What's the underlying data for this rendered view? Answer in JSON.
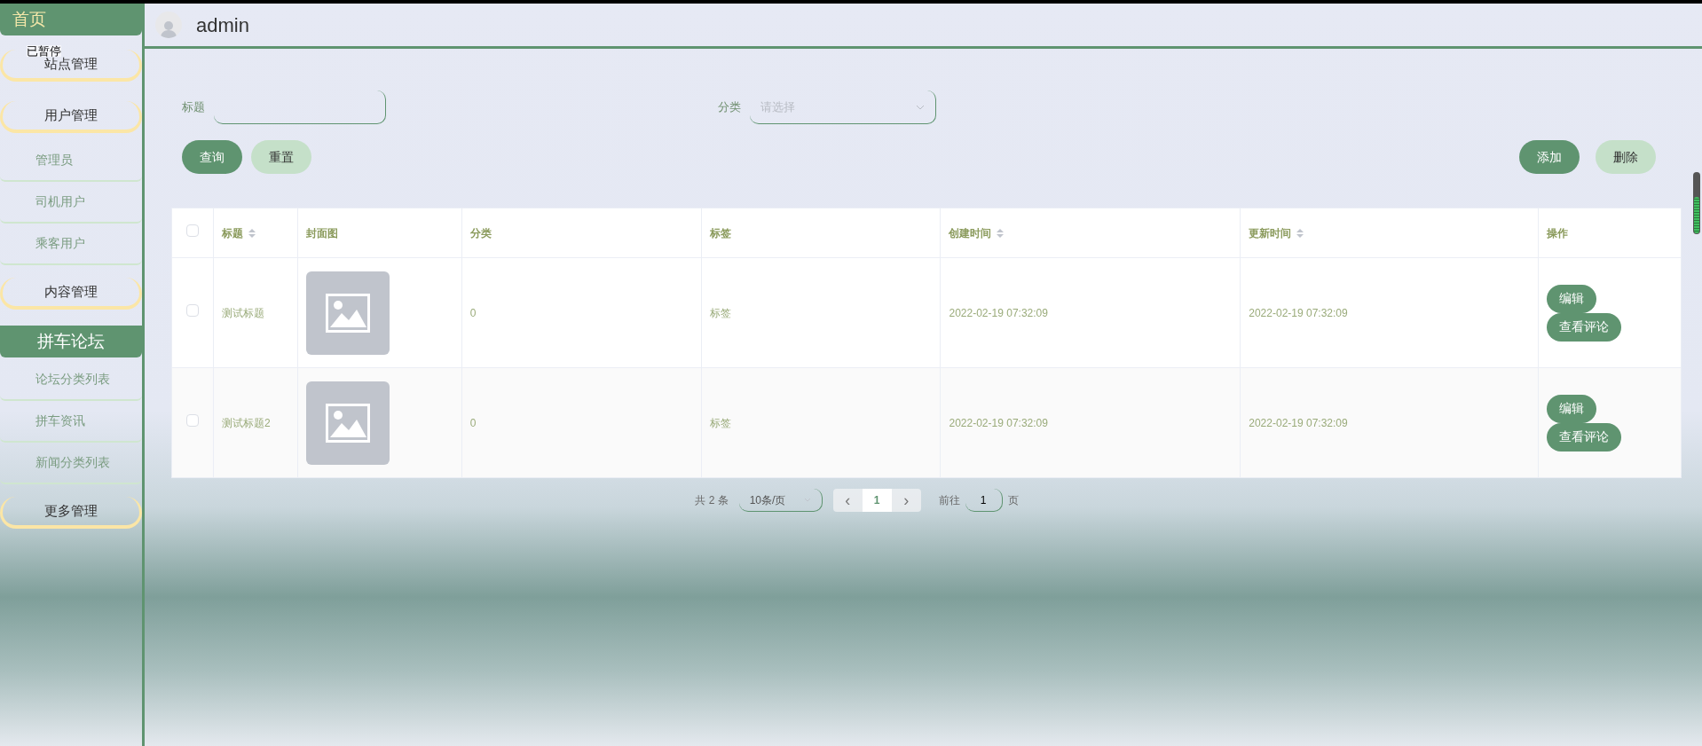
{
  "sidebar": {
    "items": [
      {
        "kind": "header",
        "label": "首页"
      },
      {
        "kind": "group",
        "label": "站点管理"
      },
      {
        "kind": "group",
        "label": "用户管理"
      },
      {
        "kind": "sub",
        "label": "管理员"
      },
      {
        "kind": "sub",
        "label": "司机用户"
      },
      {
        "kind": "sub",
        "label": "乘客用户"
      },
      {
        "kind": "group",
        "label": "内容管理"
      },
      {
        "kind": "header",
        "label": "拼车论坛"
      },
      {
        "kind": "sub",
        "label": "论坛分类列表"
      },
      {
        "kind": "sub",
        "label": "拼车资讯"
      },
      {
        "kind": "sub",
        "label": "新闻分类列表"
      },
      {
        "kind": "group",
        "label": "更多管理"
      }
    ],
    "overlay_text": "已暂停"
  },
  "header": {
    "username": "admin"
  },
  "filters": [
    {
      "kind": "text",
      "label": "标题"
    },
    {
      "kind": "select",
      "label": "分类",
      "placeholder": "请选择"
    }
  ],
  "left_buttons": [
    {
      "label": "查询",
      "primary": true
    },
    {
      "label": "重置",
      "primary": false
    }
  ],
  "right_buttons": [
    {
      "label": "添加",
      "primary": true
    },
    {
      "label": "删除",
      "primary": false
    }
  ],
  "table": {
    "select_all_checked": false,
    "columns": [
      {
        "label": "标题",
        "sortable": true
      },
      {
        "label": "封面图",
        "sortable": false
      },
      {
        "label": "分类",
        "sortable": false
      },
      {
        "label": "标签",
        "sortable": false
      },
      {
        "label": "创建时间",
        "sortable": true
      },
      {
        "label": "更新时间",
        "sortable": true
      },
      {
        "label": "操作",
        "sortable": false
      }
    ],
    "rows": [
      {
        "checked": false,
        "title": "测试标题",
        "category": "0",
        "tag": "标签",
        "created": "2022-02-19 07:32:09",
        "updated": "2022-02-19 07:32:09",
        "actions": [
          "编辑",
          "查看评论"
        ]
      },
      {
        "checked": false,
        "title": "测试标题2",
        "category": "0",
        "tag": "标签",
        "created": "2022-02-19 07:32:09",
        "updated": "2022-02-19 07:32:09",
        "actions": [
          "编辑",
          "查看评论"
        ]
      }
    ]
  },
  "pagination": {
    "total": "共 2 条",
    "page_size": "10条/页",
    "prev": "‹",
    "pages": [
      {
        "label": "1",
        "selected": true
      }
    ],
    "next": "›",
    "goto_label": "前往",
    "goto_value": "1",
    "goto_suffix": "页"
  }
}
